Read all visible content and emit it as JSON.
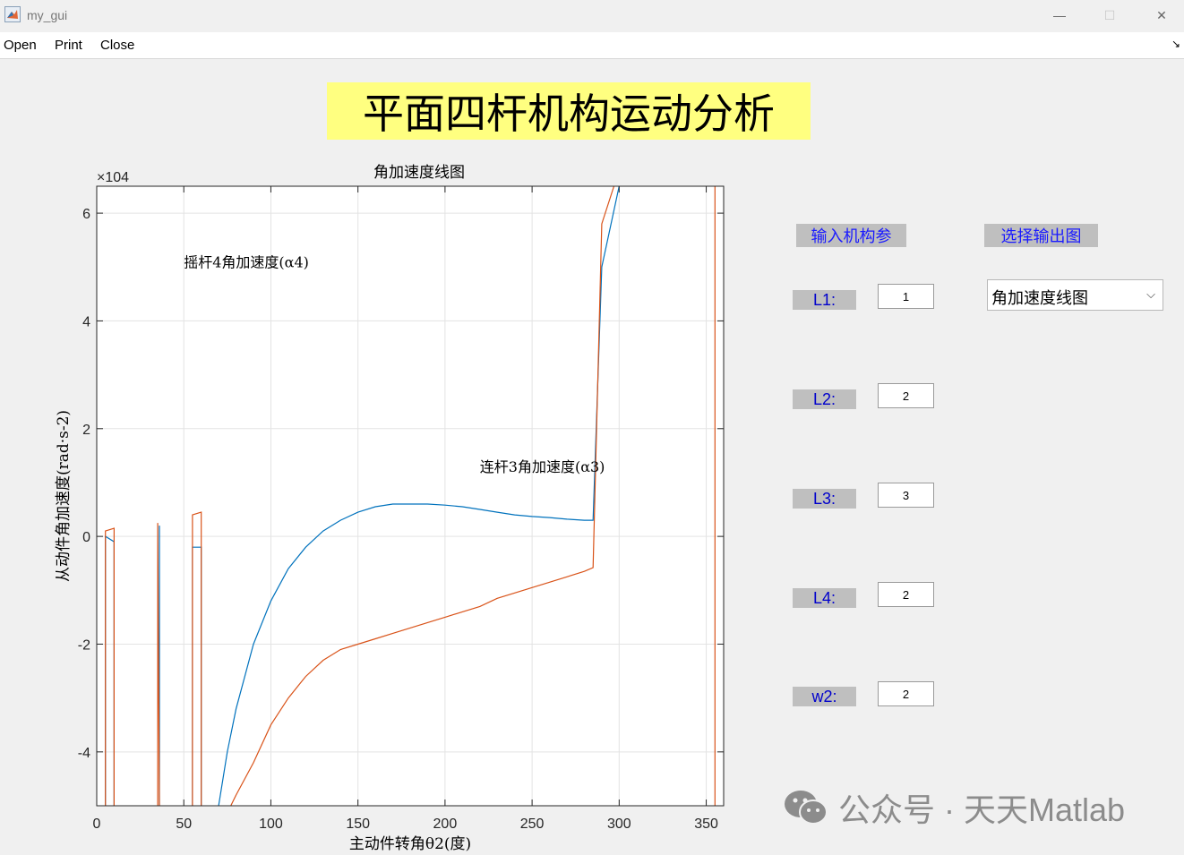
{
  "window": {
    "title": "my_gui",
    "minimize": "—",
    "maximize": "☐",
    "close": "✕"
  },
  "menu": {
    "open": "Open",
    "print": "Print",
    "close": "Close",
    "toggle": "↘"
  },
  "main_title": "平面四杆机构运动分析",
  "panel": {
    "input_header": "输入机构参",
    "output_header": "选择输出图",
    "params": [
      {
        "label": "L1:",
        "value": "1"
      },
      {
        "label": "L2:",
        "value": "2"
      },
      {
        "label": "L3:",
        "value": "3"
      },
      {
        "label": "L4:",
        "value": "2"
      },
      {
        "label": "w2:",
        "value": "2"
      }
    ],
    "plot_select": {
      "value": "角加速度线图",
      "chevron": "⌵"
    }
  },
  "watermark": {
    "text": "公众号 · 天天Matlab"
  },
  "colors": {
    "series1": "#0072bd",
    "series2": "#d95319",
    "title_bg": "#ffff80"
  },
  "chart_data": {
    "type": "line",
    "title": "角加速度线图",
    "xlabel": "主动件转角θ2(度)",
    "ylabel": "从动件角加速度(rad·s-2)",
    "y_exponent": "×10^4",
    "xlim": [
      0,
      360
    ],
    "ylim": [
      -5,
      6.5
    ],
    "xticks": [
      0,
      50,
      100,
      150,
      200,
      250,
      300,
      350
    ],
    "yticks": [
      -4,
      -2,
      0,
      2,
      4,
      6
    ],
    "grid": true,
    "annotations": [
      {
        "text": "摇杆4角加速度(α4)",
        "x": 50,
        "y": 5.0
      },
      {
        "text": "连杆3角加速度(α3)",
        "x": 220,
        "y": 1.2
      }
    ],
    "series": [
      {
        "x": [
          5,
          5,
          10,
          10,
          null,
          36,
          36,
          36,
          null,
          55,
          55,
          60,
          60,
          null,
          70,
          75,
          80,
          90,
          100,
          110,
          120,
          130,
          140,
          150,
          160,
          170,
          180,
          190,
          200,
          210,
          220,
          230,
          240,
          250,
          260,
          270,
          280,
          285,
          285,
          290,
          300
        ],
        "y": [
          -5,
          0.0,
          -0.1,
          -5,
          null,
          -5,
          0.2,
          -5,
          null,
          -5,
          -0.2,
          -0.2,
          -5,
          null,
          -5,
          -4.0,
          -3.2,
          -2.0,
          -1.2,
          -0.6,
          -0.2,
          0.1,
          0.3,
          0.45,
          0.55,
          0.6,
          0.6,
          0.6,
          0.58,
          0.55,
          0.5,
          0.45,
          0.4,
          0.37,
          0.35,
          0.32,
          0.3,
          0.3,
          0.3,
          5.0,
          6.5
        ]
      },
      {
        "x": [
          5,
          5,
          10,
          10,
          null,
          35,
          35,
          36,
          null,
          55,
          55,
          60,
          60,
          null,
          77,
          80,
          90,
          100,
          110,
          120,
          130,
          140,
          150,
          160,
          170,
          180,
          190,
          200,
          210,
          220,
          230,
          240,
          250,
          260,
          270,
          280,
          285,
          285,
          290,
          297,
          null,
          355,
          355
        ],
        "y": [
          -5,
          0.1,
          0.15,
          -5,
          null,
          -5,
          0.25,
          -5,
          null,
          -5,
          0.4,
          0.45,
          -5,
          null,
          -5,
          -4.8,
          -4.2,
          -3.5,
          -3.0,
          -2.6,
          -2.3,
          -2.1,
          -2.0,
          -1.9,
          -1.8,
          -1.7,
          -1.6,
          -1.5,
          -1.4,
          -1.3,
          -1.15,
          -1.05,
          -0.95,
          -0.85,
          -0.75,
          -0.65,
          -0.58,
          -0.58,
          5.8,
          6.5,
          null,
          -5,
          6.5
        ]
      }
    ]
  }
}
